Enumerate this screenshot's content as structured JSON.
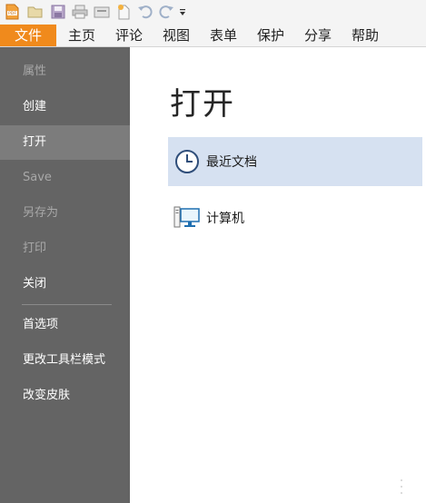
{
  "quick_access": {
    "icons": [
      "pdf-logo-icon",
      "open-folder-icon",
      "save-icon",
      "print-icon",
      "scan-icon",
      "new-doc-icon",
      "undo-icon",
      "redo-icon",
      "customize-dropdown-icon"
    ]
  },
  "ribbon": {
    "tabs": [
      {
        "label": "文件",
        "active": true
      },
      {
        "label": "主页"
      },
      {
        "label": "评论"
      },
      {
        "label": "视图"
      },
      {
        "label": "表单"
      },
      {
        "label": "保护"
      },
      {
        "label": "分享"
      },
      {
        "label": "帮助"
      }
    ]
  },
  "sidebar": {
    "items": [
      {
        "label": "属性",
        "enabled": false
      },
      {
        "label": "创建",
        "enabled": true
      },
      {
        "label": "打开",
        "enabled": true,
        "selected": true
      },
      {
        "label": "Save",
        "enabled": false
      },
      {
        "label": "另存为",
        "enabled": false
      },
      {
        "label": "打印",
        "enabled": false
      },
      {
        "label": "关闭",
        "enabled": true
      },
      {
        "label": "首选项",
        "enabled": true
      },
      {
        "label": "更改工具栏模式",
        "enabled": true
      },
      {
        "label": "改变皮肤",
        "enabled": true
      }
    ]
  },
  "main": {
    "title": "打开",
    "options": [
      {
        "label": "最近文档",
        "icon": "clock-icon",
        "selected": true
      },
      {
        "label": "计算机",
        "icon": "computer-icon",
        "selected": false
      }
    ]
  },
  "colors": {
    "accent": "#f08a1c",
    "sidebar_bg": "#646464",
    "sidebar_selected": "#7c7c7c",
    "option_selected": "#d6e1f1"
  }
}
